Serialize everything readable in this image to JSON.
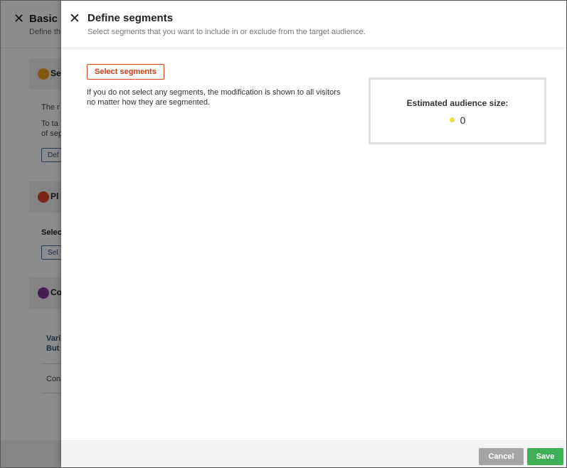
{
  "background_dialog": {
    "title": "Basic s",
    "subtitle": "Define th",
    "sections": [
      {
        "label": "Se",
        "icon": "lightbulb-icon",
        "color": "#f09a20"
      },
      {
        "label": "Pl",
        "icon": "location-arrow-icon",
        "color": "#e0432c"
      },
      {
        "label": "Co",
        "icon": "content-icon",
        "color": "#7b3a8f"
      }
    ],
    "segment_text_1": "The r",
    "segment_text_2a": "To ta",
    "segment_text_2b": "of sep",
    "define_button": "Def",
    "placement_text": "Selec",
    "placement_button": "Sel",
    "variant_line1": "Vari",
    "variant_line2": "But",
    "content_text": "Con"
  },
  "panel": {
    "title": "Define segments",
    "subtitle": "Select segments that you want to include in or exclude from the target audience.",
    "select_button": "Select segments",
    "info_text": "If you do not select any segments, the modification is shown to all visitors no matter how they are segmented.",
    "estimate_label": "Estimated audience size:",
    "estimate_value": "0",
    "cancel_label": "Cancel",
    "save_label": "Save"
  },
  "colors": {
    "accent_orange": "#c8401a",
    "save_green": "#3fb057",
    "cancel_gray": "#a5a5a5",
    "indicator_yellow": "#f3dd3a"
  }
}
